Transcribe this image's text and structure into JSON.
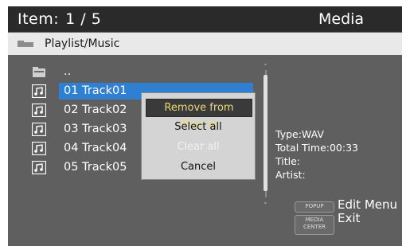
{
  "header": {
    "item_label": "Item:",
    "item_position": "1 / 5",
    "mode": "Media"
  },
  "pathbar": {
    "path": "Playlist/Music"
  },
  "list": {
    "parent_label": "..",
    "items": [
      {
        "label": "01 Track01",
        "selected": true
      },
      {
        "label": "02 Track02"
      },
      {
        "label": "03 Track03"
      },
      {
        "label": "04 Track04"
      },
      {
        "label": "05 Track05"
      }
    ]
  },
  "info": {
    "type": "Type:WAV",
    "total_time": "Total Time:00:33",
    "title": "Title:",
    "artist": "Artist:"
  },
  "popup": {
    "options": [
      {
        "label": "Remove from Playlist",
        "state": "active"
      },
      {
        "label": "Select all",
        "state": "normal"
      },
      {
        "label": "Clear all",
        "state": "disabled"
      },
      {
        "label": "Cancel",
        "state": "normal"
      }
    ]
  },
  "hints": {
    "popup_key": "POPUP",
    "popup_action": "Edit Menu",
    "media_key_line1": "MEDIA",
    "media_key_line2": "CENTER",
    "media_action": "Exit"
  },
  "colors": {
    "background": "#5f5f5f",
    "header": "#2a2a2a",
    "pathbar": "#e9e9e9",
    "selection": "#2f7fd3",
    "popup": "#d4d4d4",
    "popup_active_text": "#e9d97a"
  },
  "icons": {
    "pathbar": "folder-icon",
    "parent": "parent-folder-icon",
    "track": "music-note-icon"
  }
}
